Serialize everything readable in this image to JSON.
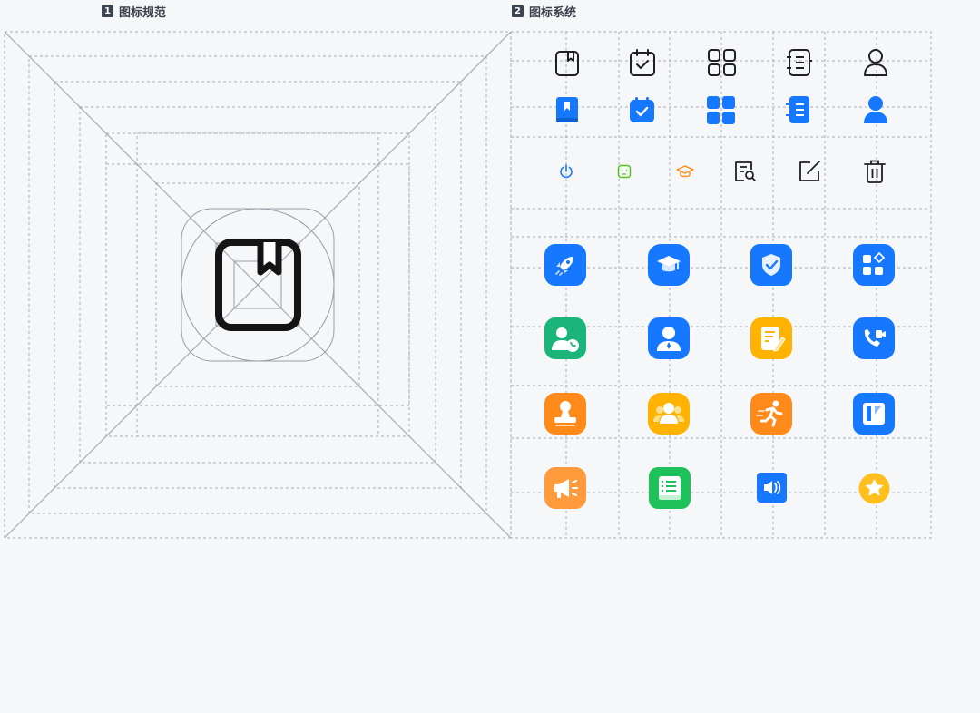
{
  "sections": {
    "spec": {
      "number": "1",
      "title": "图标规范"
    },
    "system": {
      "number": "2",
      "title": "图标系统"
    }
  },
  "palette": {
    "background": "#f6f7f9",
    "grid_line": "#a9adb5",
    "outline_icon": "#1f1f24",
    "primary_blue": "#1677ff",
    "green": "#1bb57a",
    "bright_green": "#1fc25a",
    "orange": "#ff8a1a",
    "amber": "#ffb300",
    "peach": "#ff9a3d",
    "yellow_star": "#ffc01e"
  },
  "icon_rows": {
    "outline": [
      "book-outline-icon",
      "calendar-check-outline-icon",
      "apps-outline-icon",
      "notebook-outline-icon",
      "user-outline-icon"
    ],
    "filled": [
      "book-filled-icon",
      "calendar-check-filled-icon",
      "apps-filled-icon",
      "notebook-filled-icon",
      "user-filled-icon"
    ],
    "small_line": [
      "power-icon",
      "face-icon",
      "graduation-cap-icon",
      "document-search-icon",
      "edit-icon",
      "trash-icon"
    ],
    "app_row_1": [
      "rocket-app-icon",
      "graduation-app-icon",
      "shield-check-app-icon",
      "widgets-app-icon"
    ],
    "app_row_2": [
      "contact-phone-app-icon",
      "employee-app-icon",
      "document-edit-app-icon",
      "video-call-app-icon"
    ],
    "app_row_3": [
      "stamp-app-icon",
      "group-app-icon",
      "running-app-icon",
      "layout-app-icon"
    ],
    "app_row_4": [
      "megaphone-app-icon",
      "document-list-app-icon",
      "volume-app-icon",
      "star-app-icon"
    ]
  }
}
